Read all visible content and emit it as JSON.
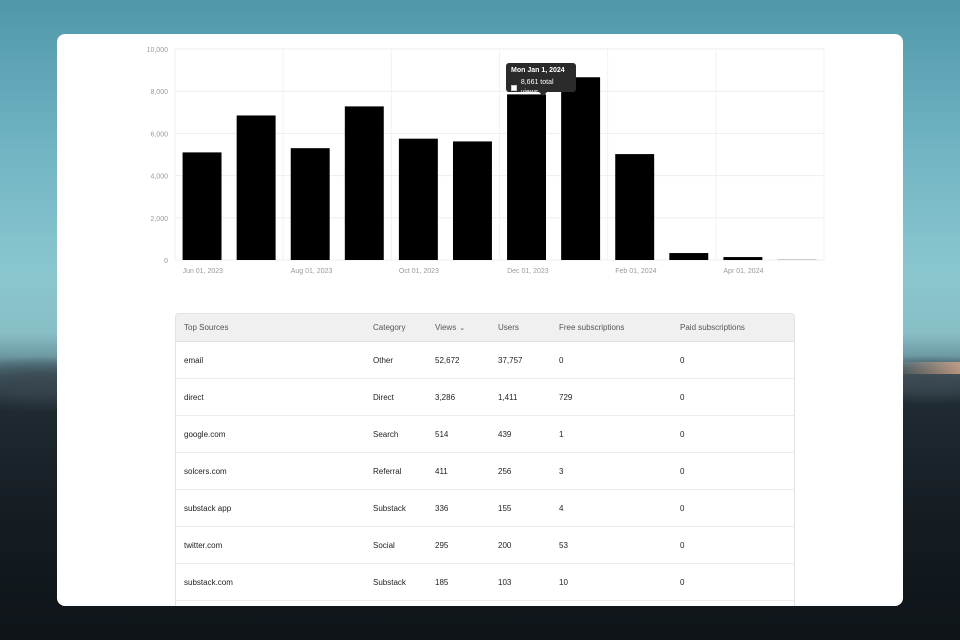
{
  "chart_data": {
    "type": "bar",
    "categories": [
      "Jun 2023",
      "Jul 2023",
      "Aug 2023",
      "Sep 2023",
      "Oct 2023",
      "Nov 2023",
      "Dec 2023",
      "Jan 2024",
      "Feb 2024",
      "Mar 2024",
      "Apr 2024",
      "May 2024"
    ],
    "values": [
      5100,
      6850,
      5300,
      7280,
      5750,
      5620,
      7850,
      8661,
      5020,
      330,
      140,
      30
    ],
    "bar_color": "#000000",
    "ylim": [
      0,
      10000
    ],
    "y_ticks": [
      "0",
      "2,000",
      "4,000",
      "6,000",
      "8,000",
      "10,000"
    ],
    "x_tick_labels": [
      "Jun 01, 2023",
      "Aug 01, 2023",
      "Oct 01, 2023",
      "Dec 01, 2023",
      "Feb 01, 2024",
      "Apr 01, 2024"
    ],
    "grid": true,
    "tooltip": {
      "date": "Mon Jan 1, 2024",
      "value_text": "8,661 total views"
    }
  },
  "table": {
    "headers": {
      "source": "Top Sources",
      "category": "Category",
      "views": "Views",
      "users": "Users",
      "free": "Free subscriptions",
      "paid": "Paid subscriptions"
    },
    "rows": [
      {
        "source": "email",
        "category": "Other",
        "views": "52,672",
        "users": "37,757",
        "free": "0",
        "paid": "0"
      },
      {
        "source": "direct",
        "category": "Direct",
        "views": "3,286",
        "users": "1,411",
        "free": "729",
        "paid": "0"
      },
      {
        "source": "google.com",
        "category": "Search",
        "views": "514",
        "users": "439",
        "free": "1",
        "paid": "0"
      },
      {
        "source": "solcers.com",
        "category": "Referral",
        "views": "411",
        "users": "256",
        "free": "3",
        "paid": "0"
      },
      {
        "source": "substack app",
        "category": "Substack",
        "views": "336",
        "users": "155",
        "free": "4",
        "paid": "0"
      },
      {
        "source": "twitter.com",
        "category": "Social",
        "views": "295",
        "users": "200",
        "free": "53",
        "paid": "0"
      },
      {
        "source": "substack.com",
        "category": "Substack",
        "views": "185",
        "users": "103",
        "free": "10",
        "paid": "0"
      }
    ]
  }
}
